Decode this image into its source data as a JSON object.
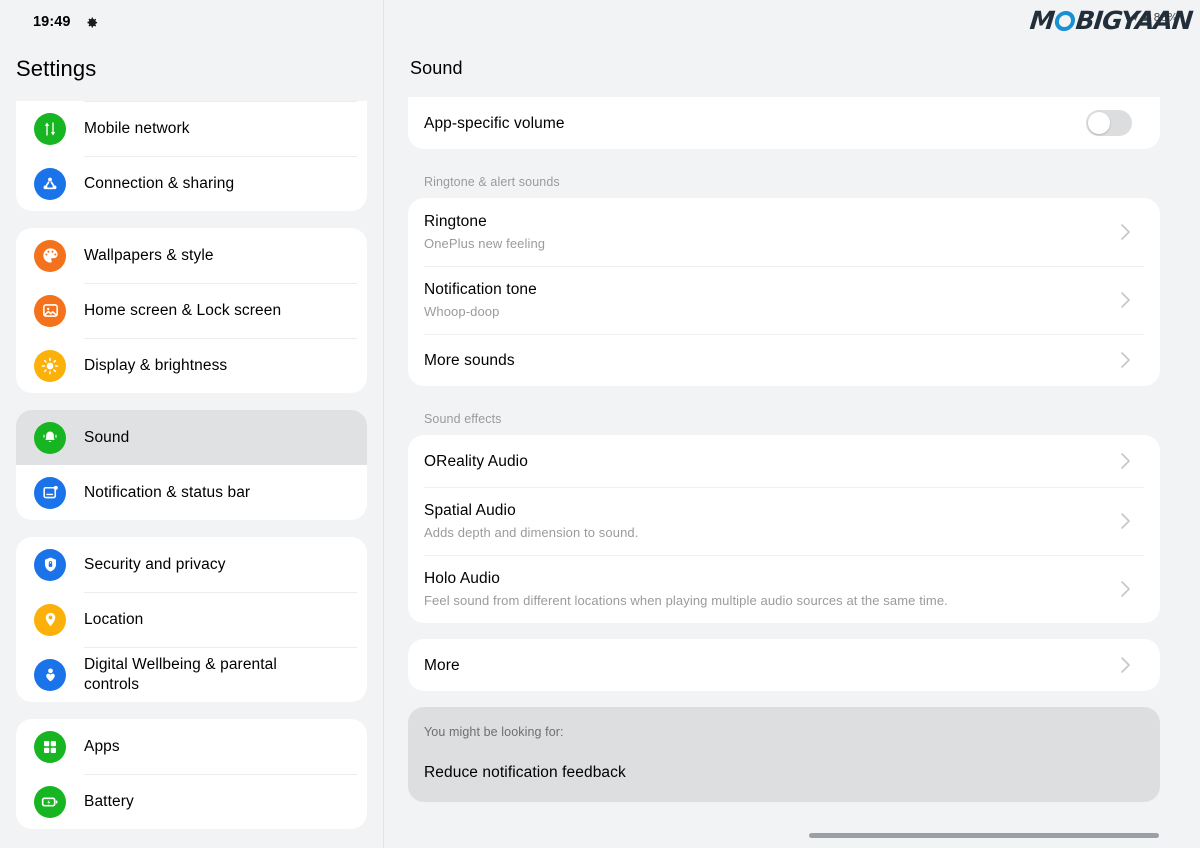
{
  "statusbar": {
    "time": "19:49",
    "gear_icon": "gear-icon",
    "right_icons": [
      "wifi-icon",
      "signal-icon",
      "battery-percent"
    ],
    "battery_text": "88%"
  },
  "watermark": {
    "text_before": "M",
    "ring": "o-ring",
    "text_after": "BIGYAAN",
    "full": "MOBIGYAAN",
    "ring_color": "#1a8fd1",
    "text_color": "#222f3a"
  },
  "sidebar": {
    "title": "Settings",
    "groups": [
      {
        "cut_top": true,
        "items": [
          {
            "label": "Mobile network",
            "icon": "mobile-network-icon",
            "color": "#18b522",
            "active": false
          },
          {
            "label": "Connection & sharing",
            "icon": "connection-sharing-icon",
            "color": "#1a73e8",
            "active": false
          }
        ]
      },
      {
        "cut_top": false,
        "items": [
          {
            "label": "Wallpapers & style",
            "icon": "palette-icon",
            "color": "#f5721c",
            "active": false
          },
          {
            "label": "Home screen & Lock screen",
            "icon": "image-icon",
            "color": "#f5721c",
            "active": false
          },
          {
            "label": "Display & brightness",
            "icon": "sun-icon",
            "color": "#fbb109",
            "active": false
          }
        ]
      },
      {
        "cut_top": false,
        "items": [
          {
            "label": "Sound",
            "icon": "bell-sound-icon",
            "color": "#18b522",
            "active": true
          },
          {
            "label": "Notification & status bar",
            "icon": "notification-bar-icon",
            "color": "#1a73e8",
            "active": false
          }
        ]
      },
      {
        "cut_top": false,
        "items": [
          {
            "label": "Security and privacy",
            "icon": "shield-lock-icon",
            "color": "#1a73e8",
            "active": false
          },
          {
            "label": "Location",
            "icon": "location-pin-icon",
            "color": "#fbb109",
            "active": false
          },
          {
            "label": "Digital Wellbeing & parental controls",
            "icon": "wellbeing-icon",
            "color": "#1a73e8",
            "active": false
          }
        ]
      },
      {
        "cut_top": false,
        "items": [
          {
            "label": "Apps",
            "icon": "apps-grid-icon",
            "color": "#18b522",
            "active": false
          },
          {
            "label": "Battery",
            "icon": "battery-icon",
            "color": "#18b522",
            "active": false
          }
        ]
      }
    ]
  },
  "detail": {
    "title": "Sound",
    "card_top": {
      "rows": [
        {
          "title": "App-specific volume",
          "sub": "",
          "control": "toggle",
          "toggle_on": false
        }
      ]
    },
    "sections": [
      {
        "label": "Ringtone & alert sounds",
        "rows": [
          {
            "title": "Ringtone",
            "sub": "OnePlus new feeling",
            "control": "chevron"
          },
          {
            "title": "Notification tone",
            "sub": "Whoop-doop",
            "control": "chevron"
          },
          {
            "title": "More sounds",
            "sub": "",
            "control": "chevron"
          }
        ]
      },
      {
        "label": "Sound effects",
        "rows": [
          {
            "title": "OReality Audio",
            "sub": "",
            "control": "chevron"
          },
          {
            "title": "Spatial Audio",
            "sub": "Adds depth and dimension to sound.",
            "control": "chevron"
          },
          {
            "title": "Holo Audio",
            "sub": "Feel sound from different locations when playing multiple audio sources at the same time.",
            "control": "chevron"
          }
        ]
      },
      {
        "label": "",
        "rows": [
          {
            "title": "More",
            "sub": "",
            "control": "chevron"
          }
        ]
      }
    ],
    "suggestion": {
      "label": "You might be looking for:",
      "item": "Reduce notification feedback"
    }
  }
}
